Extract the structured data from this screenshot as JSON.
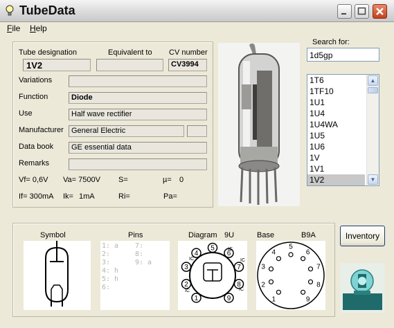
{
  "window": {
    "title": "TubeData"
  },
  "menu": {
    "file": "File",
    "help": "Help",
    "file_first": "F",
    "file_rest": "ile",
    "help_first": "H",
    "help_rest": "elp"
  },
  "header": {
    "tube_designation_label": "Tube designation",
    "equivalent_label": "Equivalent to",
    "cv_label": "CV number",
    "tube_designation": "1V2",
    "equivalent": "",
    "cv_number": "CV3994"
  },
  "fields": {
    "variations_label": "Variations",
    "variations": "",
    "function_label": "Function",
    "function": "Diode",
    "use_label": "Use",
    "use": "Half wave rectifier",
    "manufacturer_label": "Manufacturer",
    "manufacturer": "General Electric",
    "manufacturer_code": "",
    "data_book_label": "Data book",
    "data_book": "GE essential data",
    "remarks_label": "Remarks",
    "remarks": ""
  },
  "specs": {
    "vf": "Vf= 0,6V",
    "va": "Va= 7500V",
    "s": "S=",
    "mu": "µ=",
    "mu_value": "0",
    "if": "If= 300mA",
    "ik": "Ik=",
    "ik_value": "1mA",
    "ri": "Ri=",
    "pa": "Pa="
  },
  "search": {
    "label": "Search for:",
    "value": "1d5gp",
    "list": [
      "1T6",
      "1TF10",
      "1U1",
      "1U4",
      "1U4WA",
      "1U5",
      "1U6",
      "1V",
      "1V1",
      "1V2"
    ],
    "selected": "1V2"
  },
  "bottom": {
    "symbol_label": "Symbol",
    "pins_label": "Pins",
    "diagram_label": "Diagram",
    "diagram_code": "9U",
    "base_label": "Base",
    "base_code": "B9A",
    "pins_col1": [
      "1: a",
      "2:",
      "3:",
      "4: h",
      "5: h",
      "6:"
    ],
    "pins_col2": [
      "7:",
      "8:",
      "9: a"
    ],
    "diagram_pins": [
      "1",
      "2",
      "3",
      "4",
      "5",
      "6",
      "7",
      "8",
      "9"
    ],
    "diagram_ic": "IC",
    "base_pins": [
      "1",
      "2",
      "3",
      "4",
      "5",
      "6",
      "7",
      "8",
      "9"
    ]
  },
  "buttons": {
    "inventory": "Inventory"
  },
  "icons": {
    "app": "lightbulb-icon",
    "minimize": "minimize-icon",
    "maximize": "maximize-icon",
    "close": "close-icon",
    "tube_photo": "vacuum-tube-photo",
    "logo": "tube-logo"
  },
  "colors": {
    "close_button": "#c4401c",
    "listbox_border": "#7f9db9",
    "window_bg": "#ece9d8"
  }
}
